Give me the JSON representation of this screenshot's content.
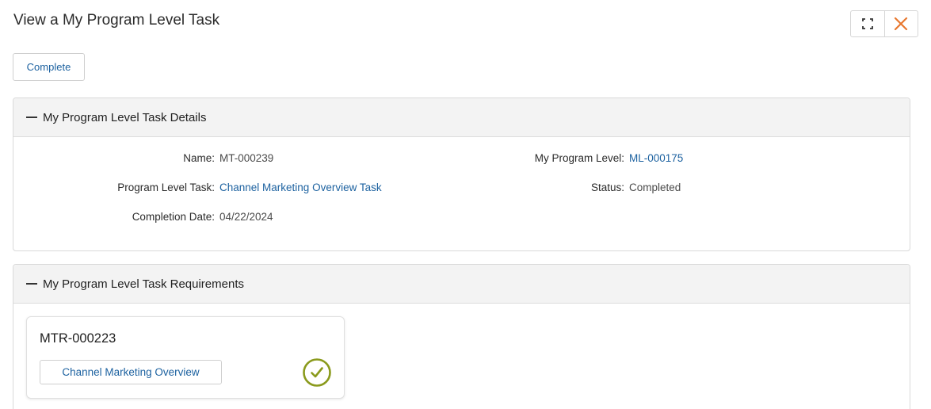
{
  "page": {
    "title": "View a My Program Level Task"
  },
  "window_controls": {
    "maximize_icon": "maximize-icon",
    "close_icon": "close-icon",
    "close_color": "#e8772e"
  },
  "toolbar": {
    "complete_label": "Complete"
  },
  "details": {
    "header": "My Program Level Task Details",
    "fields": {
      "name": {
        "label": "Name:",
        "value": "MT-000239"
      },
      "program_level_task": {
        "label": "Program Level Task:",
        "value": "Channel Marketing Overview Task"
      },
      "completion_date": {
        "label": "Completion Date:",
        "value": "04/22/2024"
      },
      "my_program_level": {
        "label": "My Program Level:",
        "value": "ML-000175"
      },
      "status": {
        "label": "Status:",
        "value": "Completed"
      }
    }
  },
  "requirements": {
    "header": "My Program Level Task Requirements",
    "items": [
      {
        "id": "MTR-000223",
        "button_label": "Channel Marketing Overview",
        "status_icon": "check-circle-icon",
        "status_color": "#8a9a1c"
      }
    ]
  },
  "colors": {
    "link": "#1d62a0",
    "header_bg": "#f3f3f3",
    "border": "#d9d9d9"
  }
}
